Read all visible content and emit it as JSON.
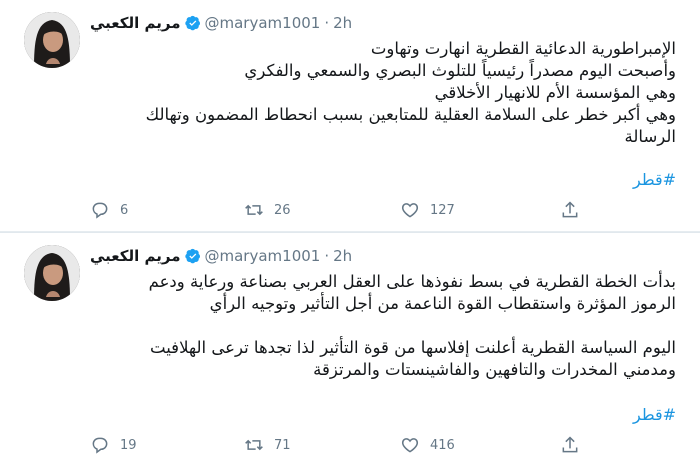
{
  "tweets": [
    {
      "author_name": "مريم الكعبي",
      "handle": "@maryam1001",
      "separator": "·",
      "time": "2h",
      "lines": [
        "الإمبراطورية الدعائية القطرية انهارت وتهاوت",
        "وأصبحت اليوم مصدراً رئيسياً للتلوث البصري والسمعي والفكري",
        "وهي المؤسسة الأم للانهيار الأخلاقي",
        "وهي أكبر خطر على السلامة العقلية للمتابعين بسبب انحطاط المضمون وتهالك",
        "الرسالة"
      ],
      "hashtag": "#قطر",
      "replies": "6",
      "retweets": "26",
      "likes": "127"
    },
    {
      "author_name": "مريم الكعبي",
      "handle": "@maryam1001",
      "separator": "·",
      "time": "2h",
      "lines": [
        "بدأت الخطة القطرية في بسط نفوذها على العقل العربي بصناعة ورعاية ودعم",
        "الرموز المؤثرة واستقطاب القوة الناعمة من أجل التأثير وتوجيه الرأي",
        "",
        "اليوم السياسة القطرية أعلنت إفلاسها من قوة التأثير لذا تجدها ترعى الهلافيت",
        "ومدمني المخدرات والتافهين والفاشينستات والمرتزقة"
      ],
      "hashtag": "#قطر",
      "replies": "19",
      "retweets": "71",
      "likes": "416"
    }
  ],
  "colors": {
    "verified": "#1da1f2",
    "hashtag": "#1b95e0",
    "muted": "#657786",
    "divider": "#e1e8ed"
  },
  "icons": {
    "reply": "reply-icon",
    "retweet": "retweet-icon",
    "like": "heart-icon",
    "share": "share-icon",
    "verified": "verified-badge-icon"
  }
}
